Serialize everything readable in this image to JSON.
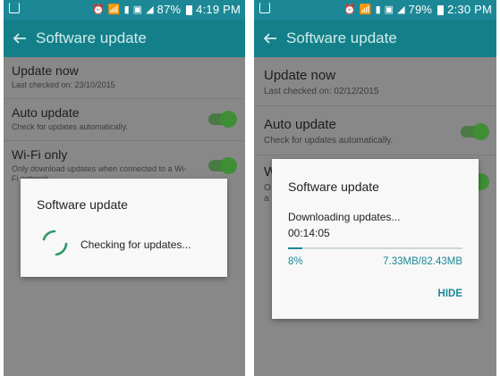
{
  "left_phone": {
    "status_bar": {
      "icons": [
        "notification-icon",
        "alarm-icon",
        "wifi-icon",
        "data-icon",
        "image-icon",
        "signal-icon"
      ],
      "battery": "87%",
      "time": "4:19 PM"
    },
    "app_bar": {
      "title": "Software update"
    },
    "items": [
      {
        "title": "Update now",
        "subtitle": "Last checked on: 23/10/2015"
      },
      {
        "title": "Auto update",
        "subtitle": "Check for updates automatically.",
        "toggle": true
      },
      {
        "title": "Wi-Fi only",
        "subtitle": "Only download updates when connected to a Wi-",
        "subtitle_line2": "Fi network.",
        "toggle": true
      }
    ],
    "dialog": {
      "title": "Software update",
      "message": "Checking for updates..."
    }
  },
  "right_phone": {
    "status_bar": {
      "icons": [
        "notification-icon",
        "alarm-icon",
        "wifi-icon",
        "data-icon",
        "image-icon",
        "signal-icon"
      ],
      "battery": "79%",
      "time": "2:30 PM"
    },
    "app_bar": {
      "title": "Software update"
    },
    "items": [
      {
        "title": "Update now",
        "subtitle": "Last checked on: 02/12/2015"
      },
      {
        "title": "Auto update",
        "subtitle": "Check for updates automatically.",
        "toggle": true
      },
      {
        "title": "W",
        "subtitle_1": "O",
        "subtitle_2": "a"
      }
    ],
    "dialog": {
      "title": "Software update",
      "message": "Downloading updates...",
      "elapsed": "00:14:05",
      "progress_percent": 8,
      "progress_label": "8%",
      "size": "7.33MB/82.43MB",
      "hide_label": "HIDE"
    }
  },
  "colors": {
    "accent": "#1c8896",
    "toggle_on": "#3f8e36"
  }
}
